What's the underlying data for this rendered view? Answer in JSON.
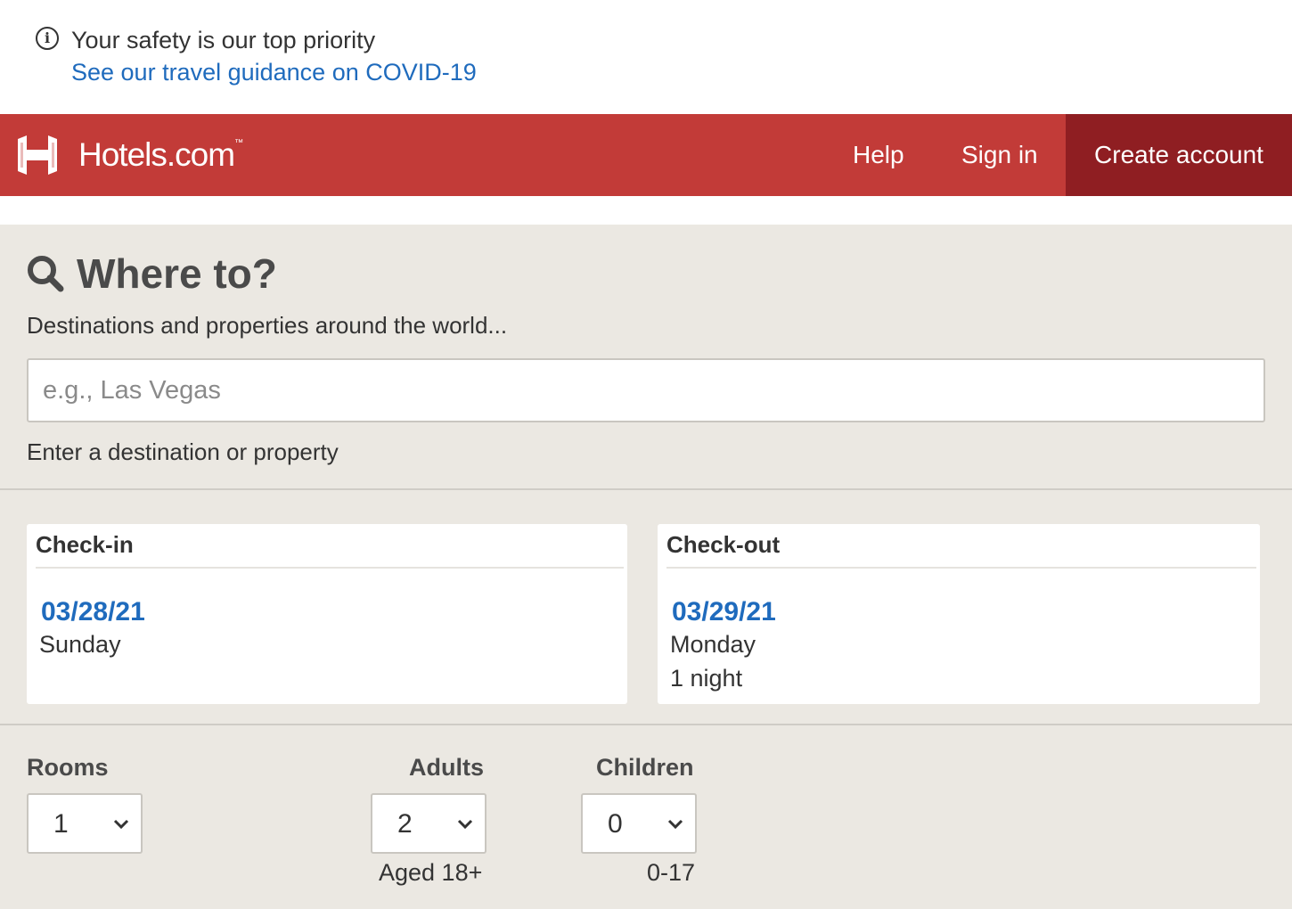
{
  "banner": {
    "icon": "info-icon",
    "title": "Your safety is our top priority",
    "link": "See our travel guidance on COVID-19",
    "link_color": "#1f6bbd"
  },
  "header": {
    "brand": "Hotels.com",
    "trademark": "™",
    "logo_icon": "hotels-h-logo-icon",
    "nav": {
      "help": "Help",
      "sign_in": "Sign in",
      "create_account": "Create account"
    },
    "bg_color": "#c23b38",
    "accent_color": "#8f1e22"
  },
  "search": {
    "icon": "search-icon",
    "title": "Where to?",
    "subtitle": "Destinations and properties around the world...",
    "placeholder": "e.g., Las Vegas",
    "hint": "Enter a destination or property"
  },
  "dates": {
    "checkin": {
      "label": "Check-in",
      "date": "03/28/21",
      "day": "Sunday"
    },
    "checkout": {
      "label": "Check-out",
      "date": "03/29/21",
      "day": "Monday",
      "nights": "1 night"
    }
  },
  "occupancy": {
    "rooms": {
      "label": "Rooms",
      "value": "1"
    },
    "adults": {
      "label": "Adults",
      "value": "2",
      "note": "Aged 18+"
    },
    "children": {
      "label": "Children",
      "value": "0",
      "note": "0-17"
    }
  }
}
